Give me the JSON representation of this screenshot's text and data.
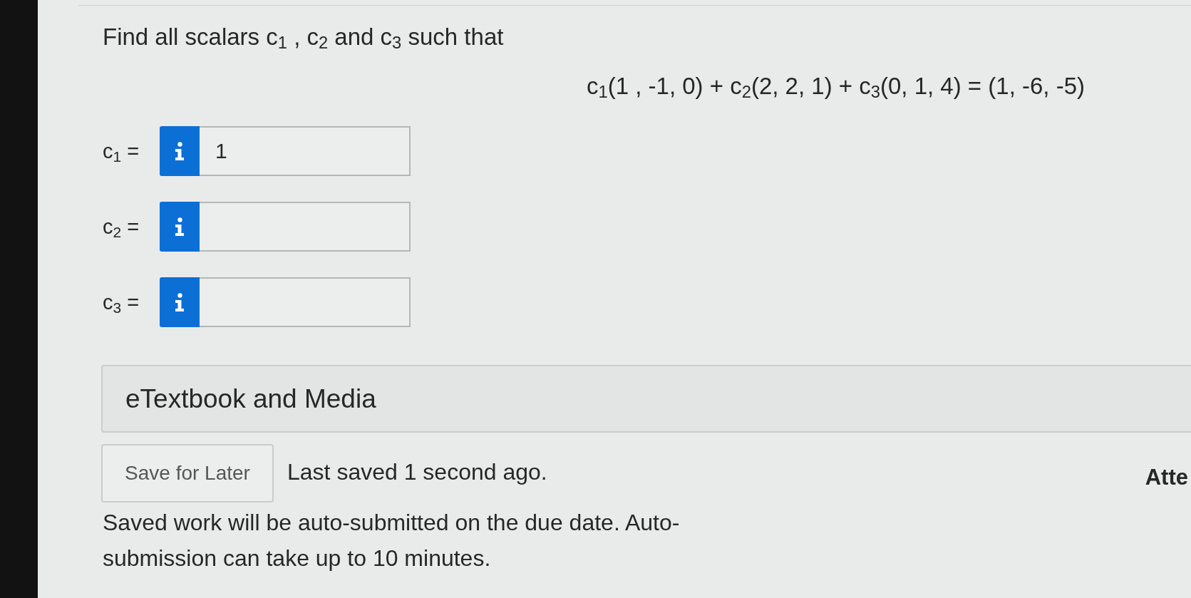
{
  "question": {
    "prompt": "Find all scalars c$_{1}$ , c$_{2}$ and c$_{3}$ such that",
    "equation": "c$_{1}$(1 , -1, 0) + c$_{2}$(2, 2, 1) + c$_{3}$(0, 1, 4) = (1, -6, -5)"
  },
  "answers": [
    {
      "label": "c$_{1}$ =",
      "value": "1"
    },
    {
      "label": "c$_{2}$ ="
    },
    {
      "label": "c$_{3}$ ="
    }
  ],
  "resources_panel": {
    "title": "eTextbook and Media"
  },
  "save": {
    "button": "Save for Later",
    "status": "Last saved 1 second ago.",
    "note": "Saved work will be auto-submitted on the due date. Auto-submission can take up to 10 minutes."
  },
  "side_heading": "Atte"
}
